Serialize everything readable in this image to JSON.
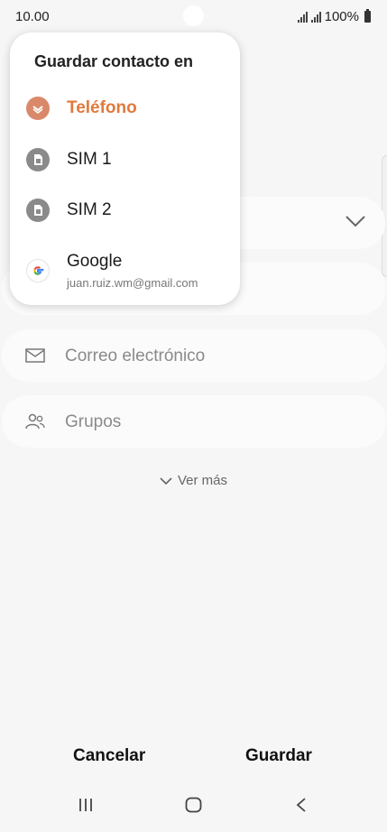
{
  "status_bar": {
    "time": "10.00",
    "battery": "100%"
  },
  "popup": {
    "title": "Guardar contacto en",
    "items": [
      {
        "label": "Teléfono",
        "icon": "phone-storage-icon",
        "selected": true
      },
      {
        "label": "SIM 1",
        "icon": "sim-card-icon"
      },
      {
        "label": "SIM 2",
        "icon": "sim-card-icon"
      },
      {
        "label": "Google",
        "icon": "google-icon",
        "sublabel": "juan.ruiz.wm@gmail.com"
      }
    ]
  },
  "form": {
    "email_label": "Correo electrónico",
    "groups_label": "Grupos",
    "see_more": "Ver más"
  },
  "actions": {
    "cancel": "Cancelar",
    "save": "Guardar"
  },
  "colors": {
    "accent": "#e07a3c",
    "phone_icon_bg": "#d9896a",
    "sim_icon_bg": "#8a8a8a"
  }
}
